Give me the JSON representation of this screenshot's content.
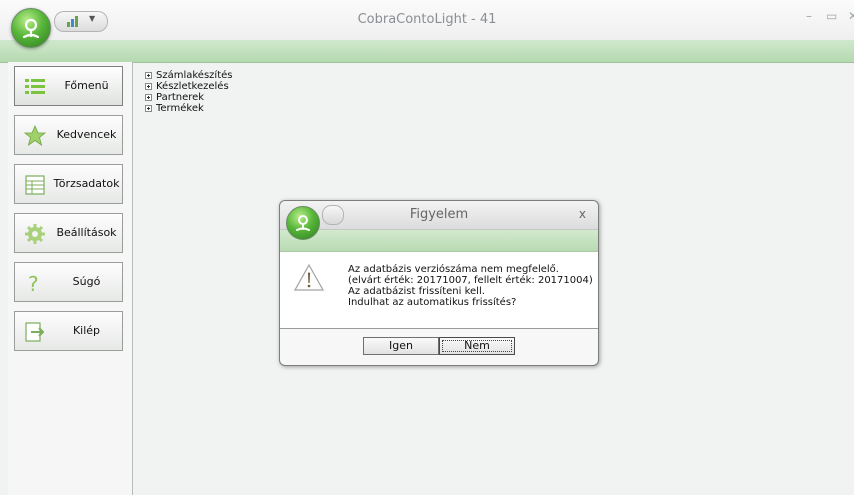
{
  "window": {
    "title": "CobraContoLight - 41"
  },
  "sidebar": {
    "items": [
      {
        "label": "Főmenü",
        "icon": "list-icon"
      },
      {
        "label": "Kedvencek",
        "icon": "star-icon"
      },
      {
        "label": "Törzsadatok",
        "icon": "table-icon"
      },
      {
        "label": "Beállítások",
        "icon": "gear-icon"
      },
      {
        "label": "Súgó",
        "icon": "question-icon"
      },
      {
        "label": "Kilép",
        "icon": "exit-icon"
      }
    ]
  },
  "tree": {
    "items": [
      "Számlakészítés",
      "Készletkezelés",
      "Partnerek",
      "Termékek"
    ]
  },
  "dialog": {
    "title": "Figyelem",
    "close": "x",
    "lines": [
      "Az adatbázis verziószáma nem megfelelő.",
      "(elvárt érték: 20171007, fellelt érték: 20171004)",
      "Az adatbázist frissíteni kell.",
      "Indulhat az automatikus frissítés?"
    ],
    "yes_label": "Igen",
    "no_label": "Nem"
  },
  "colors": {
    "ribbon": "#b5d9b0",
    "orb": "#58b63a"
  }
}
